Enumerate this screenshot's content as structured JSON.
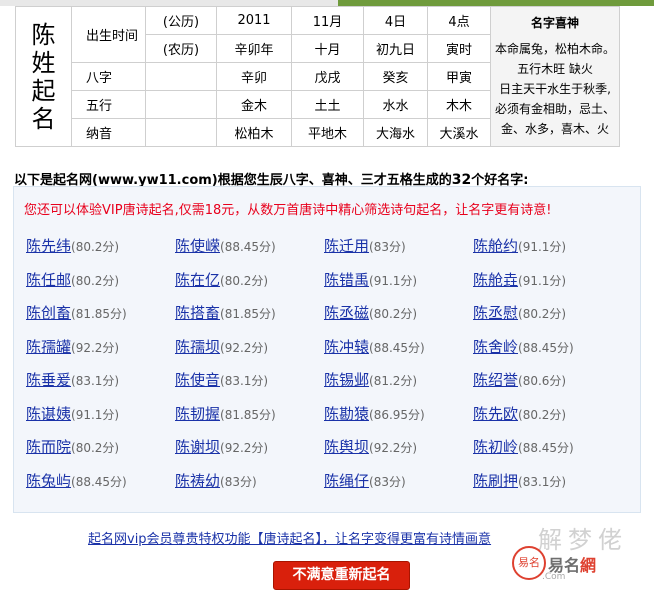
{
  "table": {
    "surname_chars": [
      "陈",
      "姓",
      "起",
      "名"
    ],
    "row1": {
      "label": "出生时间",
      "cal": "(公历)",
      "year": "2011",
      "month": "11月",
      "day": "4日",
      "hour": "4点"
    },
    "row2": {
      "cal": "(农历)",
      "year": "辛卯年",
      "month": "十月",
      "day": "初九日",
      "hour": "寅时"
    },
    "row3": {
      "label": "八字",
      "c1": "辛卯",
      "c2": "戊戌",
      "c3": "癸亥",
      "c4": "甲寅"
    },
    "row4": {
      "label": "五行",
      "c1": "金木",
      "c2": "土土",
      "c3": "水水",
      "c4": "木木"
    },
    "row5": {
      "label": "纳音",
      "c1": "松柏木",
      "c2": "平地木",
      "c3": "大海水",
      "c4": "大溪水"
    },
    "name_god": {
      "title": "名字喜神",
      "lines": [
        "本命属兔，松柏木命。",
        "五行木旺 缺火",
        "日主天干水生于秋季,",
        "必须有金相助，忌土、",
        "金、水多，喜木、火"
      ]
    }
  },
  "intro": {
    "prefix": "以下是起名网",
    "site": "(www.yw11.com)",
    "middle": "根据您生辰八字、喜神、三才五格生成的",
    "count": "32",
    "suffix": "个好名字:"
  },
  "vip_notice": "您还可以体验VIP唐诗起名,仅需18元，从数万首唐诗中精心筛选诗句起名，让名字更有诗意!",
  "names": [
    [
      {
        "n": "陈先纬",
        "s": "(80.2分)"
      },
      {
        "n": "陈使嵘",
        "s": "(88.45分)"
      },
      {
        "n": "陈迁用",
        "s": "(83分)"
      },
      {
        "n": "陈舱约",
        "s": "(91.1分)"
      }
    ],
    [
      {
        "n": "陈任邮",
        "s": "(80.2分)"
      },
      {
        "n": "陈在亿",
        "s": "(80.2分)"
      },
      {
        "n": "陈错禹",
        "s": "(91.1分)"
      },
      {
        "n": "陈舱垚",
        "s": "(91.1分)"
      }
    ],
    [
      {
        "n": "陈创畜",
        "s": "(81.85分)"
      },
      {
        "n": "陈搭畜",
        "s": "(81.85分)"
      },
      {
        "n": "陈丞磁",
        "s": "(80.2分)"
      },
      {
        "n": "陈丞慰",
        "s": "(80.2分)"
      }
    ],
    [
      {
        "n": "陈孺罐",
        "s": "(92.2分)"
      },
      {
        "n": "陈孺坝",
        "s": "(92.2分)"
      },
      {
        "n": "陈冲辕",
        "s": "(88.45分)"
      },
      {
        "n": "陈舍岭",
        "s": "(88.45分)"
      }
    ],
    [
      {
        "n": "陈垂爰",
        "s": "(83.1分)"
      },
      {
        "n": "陈使音",
        "s": "(83.1分)"
      },
      {
        "n": "陈锡邺",
        "s": "(81.2分)"
      },
      {
        "n": "陈绍誉",
        "s": "(80.6分)"
      }
    ],
    [
      {
        "n": "陈谌姨",
        "s": "(91.1分)"
      },
      {
        "n": "陈韧握",
        "s": "(81.85分)"
      },
      {
        "n": "陈勘猿",
        "s": "(86.95分)"
      },
      {
        "n": "陈先欧",
        "s": "(80.2分)"
      }
    ],
    [
      {
        "n": "陈而院",
        "s": "(80.2分)"
      },
      {
        "n": "陈谢坝",
        "s": "(92.2分)"
      },
      {
        "n": "陈舆坝",
        "s": "(92.2分)"
      },
      {
        "n": "陈初岭",
        "s": "(88.45分)"
      }
    ],
    [
      {
        "n": "陈兔屿",
        "s": "(88.45分)"
      },
      {
        "n": "陈祷幼",
        "s": "(83分)"
      },
      {
        "n": "陈绳仔",
        "s": "(83分)"
      },
      {
        "n": "陈刷押",
        "s": "(83.1分)"
      }
    ]
  ],
  "bottom_link": "起名网vip会员尊贵特权功能【唐诗起名】，让名字变得更富有诗情画意",
  "button_label": "不满意重新起名",
  "watermark": {
    "text": "解梦佬",
    "logo_a": "易名",
    "logo_b": "網",
    "domain": ".Com",
    "seal": "易名"
  },
  "colors": {
    "link": "#1a32a8",
    "vip_red": "#e8001c",
    "button": "#d9200c",
    "box_bg": "#f3f6fb"
  }
}
